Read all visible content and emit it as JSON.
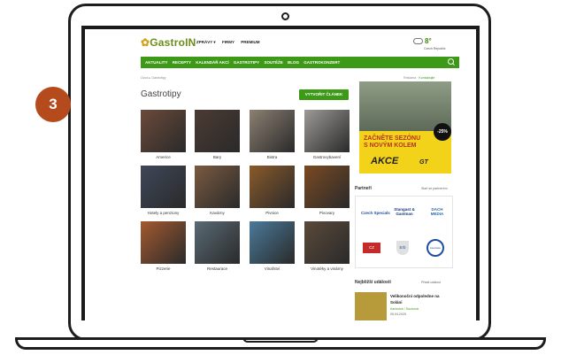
{
  "site": {
    "logo": "GastroIN",
    "topnav": [
      "ZPRÁVY ▾",
      "FIRMY",
      "PREMIUM"
    ],
    "weather": {
      "temp": "8°",
      "location": "Czech Republic"
    }
  },
  "greennav": [
    "AKTUALITY",
    "RECEPTY",
    "KALENDÁŘ AKCÍ",
    "GASTROTIPY",
    "SOUTĚŽE",
    "BLOG",
    "GASTROKONZERT"
  ],
  "breadcrumb": {
    "home": "Úvod",
    "current": "Gastrotipy",
    "right_a": "Reklama",
    "right_b": "Kontaktujte"
  },
  "page": {
    "title": "Gastrotipy",
    "new_button": "VYTVOŘIT ČLÁNEK"
  },
  "badge": "3",
  "categories": [
    {
      "label": "Americe",
      "color": "#6b4a3a"
    },
    {
      "label": "Bary",
      "color": "#4b3a33"
    },
    {
      "label": "Bistra",
      "color": "#8c8072"
    },
    {
      "label": "Gastrovybavení",
      "color": "#9c9a96"
    },
    {
      "label": "Hotely a penziony",
      "color": "#3e4759"
    },
    {
      "label": "Kavárny",
      "color": "#7a5a40"
    },
    {
      "label": "Pivnice",
      "color": "#8a5a2a"
    },
    {
      "label": "Pivovary",
      "color": "#7a4a22"
    },
    {
      "label": "Pizzerie",
      "color": "#a45a30"
    },
    {
      "label": "Restaurace",
      "color": "#5a6a74"
    },
    {
      "label": "Vinařství",
      "color": "#4a7a9a"
    },
    {
      "label": "Vinotéky a vinárny",
      "color": "#5a4a3a"
    }
  ],
  "ad": {
    "pct": "-25%",
    "line1": "ZAČNĚTE SEZÓNU",
    "line2": "S NOVÝM KOLEM",
    "akce": "AKCE",
    "brand": "GT"
  },
  "partners": {
    "heading": "Partneři",
    "link": "Staň se partnerem",
    "logos": [
      "Czech Specials",
      "Stangast & Gastman",
      "DACH MEDIA",
      "CZ",
      "Erb",
      "Asociace"
    ]
  },
  "events": {
    "heading": "Nejbližší události",
    "link": "Přidat událost",
    "item": {
      "title": "Velikonoční odpoledne na Soláni",
      "place": "Karlovice / Sochová",
      "date": "05.04.2025"
    }
  }
}
